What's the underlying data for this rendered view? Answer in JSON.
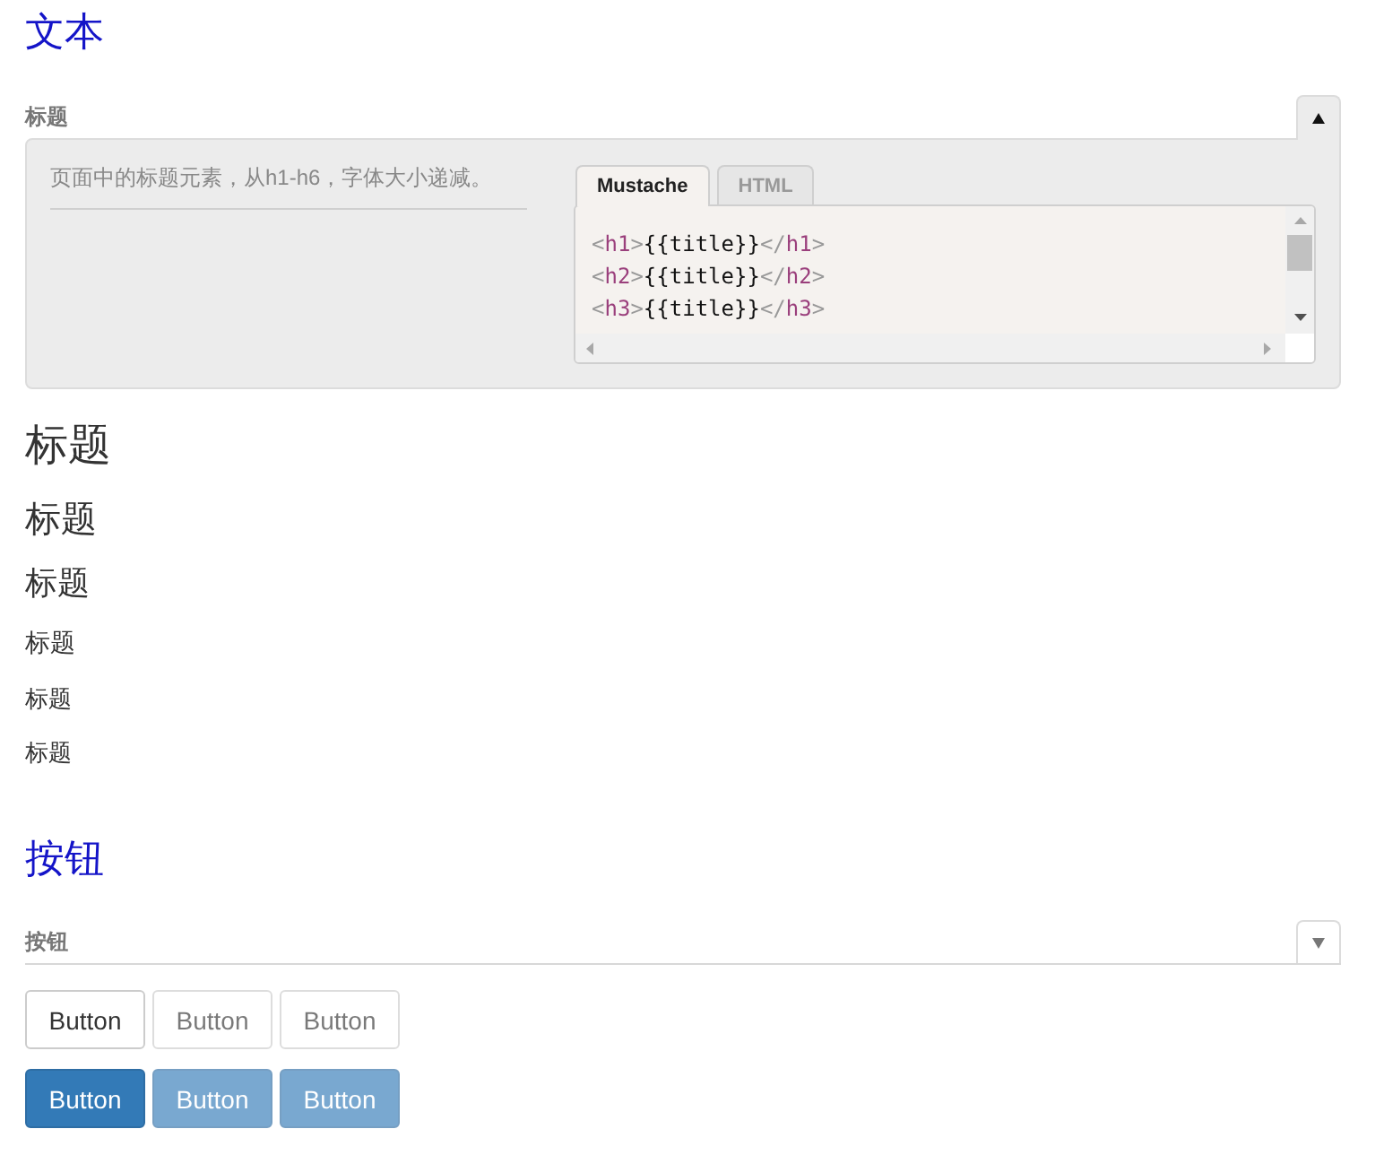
{
  "sections": [
    {
      "title": "文本",
      "demo": {
        "label": "标题",
        "expanded": true,
        "description": "页面中的标题元素，从h1-h6，字体大小递减。",
        "tabs": [
          {
            "label": "Mustache",
            "selected": true
          },
          {
            "label": "HTML",
            "selected": false
          }
        ],
        "code_lines": [
          "<h1>{{title}}</h1>",
          "<h2>{{title}}</h2>",
          "<h3>{{title}}</h3>"
        ]
      },
      "headings": [
        {
          "kind": "h1",
          "text": "标题"
        },
        {
          "kind": "h2",
          "text": "标题"
        },
        {
          "kind": "h3",
          "text": "标题"
        },
        {
          "kind": "h4",
          "text": "标题"
        },
        {
          "kind": "h5",
          "text": "标题"
        },
        {
          "kind": "h6",
          "text": "标题"
        }
      ]
    },
    {
      "title": "按钮",
      "demo": {
        "label": "按钮",
        "expanded": false
      },
      "button_rows": [
        {
          "kind": "default",
          "buttons": [
            {
              "label": "Button",
              "disabled": false
            },
            {
              "label": "Button",
              "disabled": true
            },
            {
              "label": "Button",
              "disabled": true
            }
          ]
        },
        {
          "kind": "primary",
          "buttons": [
            {
              "label": "Button",
              "disabled": false
            },
            {
              "label": "Button",
              "disabled": true
            },
            {
              "label": "Button",
              "disabled": true
            }
          ]
        }
      ]
    }
  ]
}
